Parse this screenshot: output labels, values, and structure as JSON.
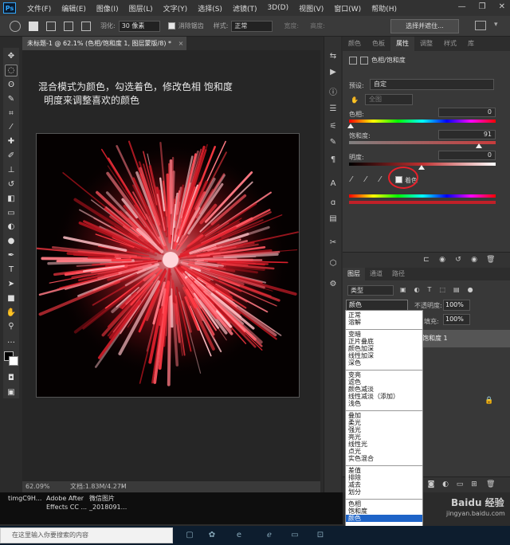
{
  "app": {
    "logo": "Ps",
    "menu": [
      "文件(F)",
      "编辑(E)",
      "图像(I)",
      "图层(L)",
      "文字(Y)",
      "选择(S)",
      "滤镜(T)",
      "3D(D)",
      "视图(V)",
      "窗口(W)",
      "帮助(H)"
    ],
    "window_controls": [
      "—",
      "❐",
      "✕"
    ]
  },
  "options_bar": {
    "feather_label": "羽化:",
    "feather_value": "30 像素",
    "antialias_label": "消除锯齿",
    "style_label": "样式:",
    "style_value": "正常",
    "width_label": "宽度:",
    "height_label": "高度:",
    "select_mask_button": "选择并遮住..."
  },
  "document": {
    "tab_title": "未标题-1 @ 62.1% (色相/饱和度 1, 图层蒙版/8) *",
    "tab_close": "×",
    "annotation_line1": "混合模式为颜色，勾选着色，修改色相  饱和度",
    "annotation_line2": "明度来调整喜欢的颜色",
    "status_zoom": "62.09%",
    "status_doc": "文档:1.83M/4.27M",
    "status_arrow": "›"
  },
  "properties": {
    "tabs": [
      "颜色",
      "色板",
      "属性",
      "调整",
      "样式",
      "库"
    ],
    "active_tab": "属性",
    "title": "色相/饱和度",
    "preset_label": "预设:",
    "preset_value": "自定",
    "channel_value": "全图",
    "hue_label": "色相:",
    "hue_value": "0",
    "saturation_label": "饱和度:",
    "saturation_value": "91",
    "lightness_label": "明度:",
    "lightness_value": "0",
    "colorize_label": "着色"
  },
  "layers": {
    "tabs": [
      "图层",
      "通道",
      "路径"
    ],
    "active_tab": "图层",
    "filter_value": "类型",
    "blend_mode": "颜色",
    "opacity_label": "不透明度:",
    "opacity_value": "100%",
    "fill_label": "填充:",
    "fill_value": "100%",
    "layer_name": "饱和度 1"
  },
  "blend_dropdown": {
    "groups": [
      [
        "正常",
        "溶解"
      ],
      [
        "变暗",
        "正片叠底",
        "颜色加深",
        "线性加深",
        "深色"
      ],
      [
        "变亮",
        "滤色",
        "颜色减淡",
        "线性减淡（添加）",
        "浅色"
      ],
      [
        "叠加",
        "柔光",
        "强光",
        "亮光",
        "线性光",
        "点光",
        "实色混合"
      ],
      [
        "差值",
        "排除",
        "减去",
        "划分"
      ],
      [
        "色相",
        "饱和度",
        "颜色"
      ]
    ],
    "selected": "颜色"
  },
  "filestrip": {
    "item1": "timgC9H...",
    "item2a": "Adobe After",
    "item2b": "Effects CC ...",
    "item3a": "微信图片",
    "item3b": "_2018091..."
  },
  "taskbar": {
    "search_placeholder": "在这里输入你要搜索的内容"
  },
  "watermark": {
    "text": "Baidu 经验",
    "url": "jingyan.baidu.com"
  },
  "colors": {
    "accent_red": "#e8202a",
    "firework_red": "#c81e28",
    "selection_blue": "#1e64c8"
  }
}
